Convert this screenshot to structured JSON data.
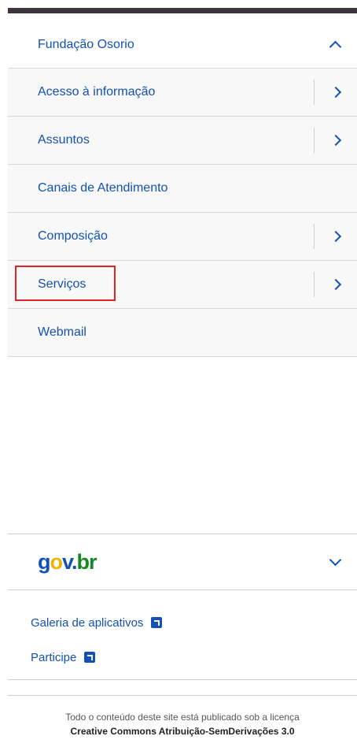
{
  "menu": {
    "header": "Fundação Osorio",
    "items": [
      {
        "label": "Acesso à informação",
        "has_submenu": true
      },
      {
        "label": "Assuntos",
        "has_submenu": true
      },
      {
        "label": "Canais de Atendimento",
        "has_submenu": false
      },
      {
        "label": "Composição",
        "has_submenu": true
      },
      {
        "label": "Serviços",
        "has_submenu": true,
        "highlighted": true
      },
      {
        "label": "Webmail",
        "has_submenu": false
      }
    ]
  },
  "logo": {
    "g": "g",
    "o": "o",
    "v": "v",
    "dot": ".",
    "br": "br"
  },
  "links": [
    {
      "label": "Galeria de aplicativos",
      "icon": "external-link-icon"
    },
    {
      "label": "Participe",
      "icon": "external-link-icon"
    }
  ],
  "footer": {
    "line1": "Todo o conteúdo deste site está publicado sob a licença",
    "line2": "Creative Commons Atribuição-SemDerivações 3.0"
  },
  "colors": {
    "accent": "#1351b4",
    "highlight": "#e0232b",
    "gov_yellow": "#f0b400",
    "gov_green": "#168821"
  }
}
